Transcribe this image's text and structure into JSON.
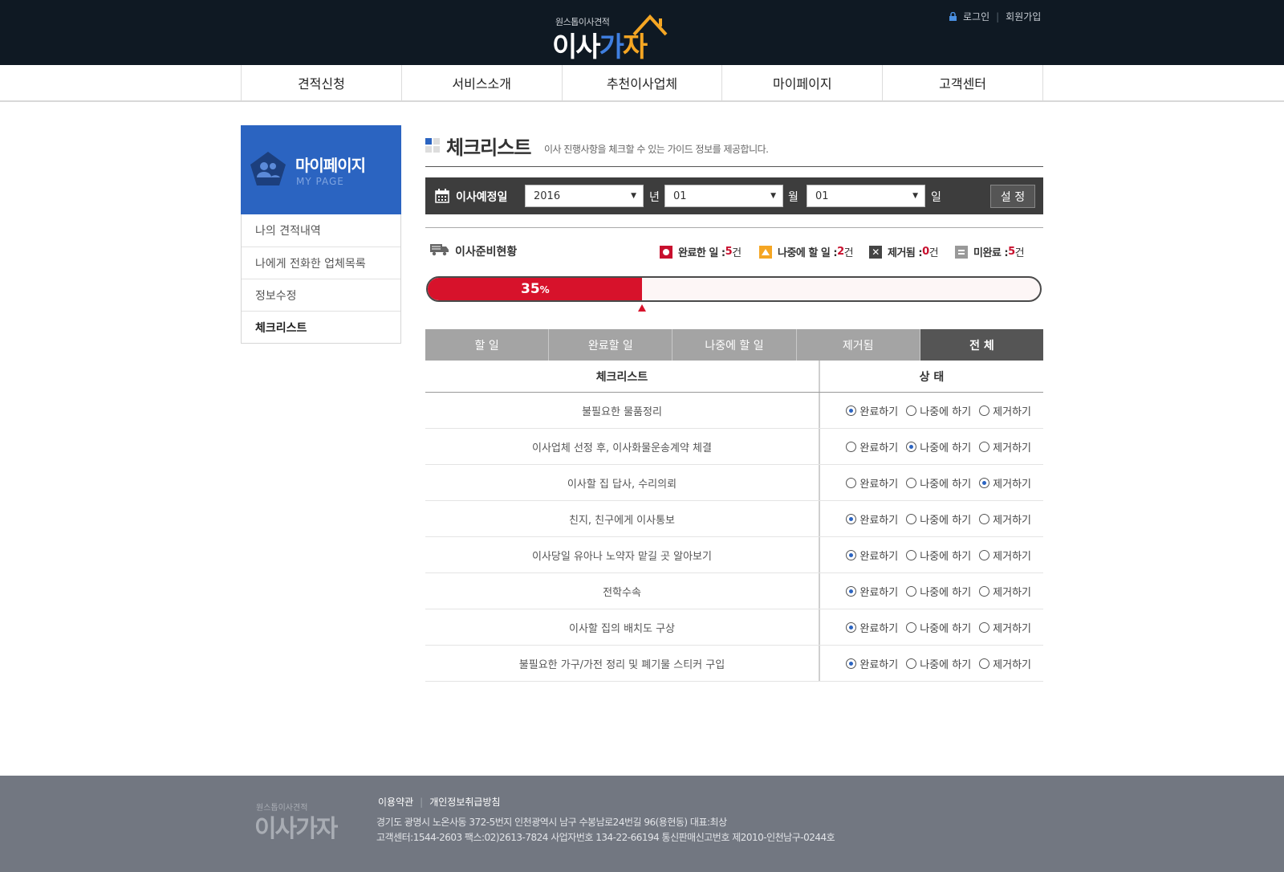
{
  "header": {
    "logo_small": "원스톱이사견적",
    "logo_part1": "이사",
    "logo_part2": "가",
    "logo_part3": "자",
    "login": "로그인",
    "signup": "회원가입"
  },
  "gnb": [
    "견적신청",
    "서비스소개",
    "추천이사업체",
    "마이페이지",
    "고객센터"
  ],
  "sidebar": {
    "title": "마이페이지",
    "subtitle": "MY PAGE",
    "items": [
      {
        "label": "나의 견적내역"
      },
      {
        "label": "나에게 전화한 업체목록"
      },
      {
        "label": "정보수정"
      },
      {
        "label": "체크리스트"
      }
    ]
  },
  "main": {
    "title": "체크리스트",
    "description": "이사 진행사항을 체크할 수 있는 가이드 정보를 제공합니다."
  },
  "date_bar": {
    "label": "이사예정일",
    "year": "2016",
    "year_unit": "년",
    "month": "01",
    "month_unit": "월",
    "day": "01",
    "day_unit": "일",
    "set_button": "설 정"
  },
  "status": {
    "title": "이사준비현황",
    "done_label": "완료한 일 : ",
    "done_count": "5",
    "later_label": "나중에 할 일 : ",
    "later_count": "2",
    "removed_label": "제거됨 : ",
    "removed_count": "0",
    "incomplete_label": "미완료 : ",
    "incomplete_count": "5",
    "count_unit": "건",
    "progress_value": "35",
    "progress_unit": "%",
    "colors": {
      "done": "#d7122b",
      "later": "#f5a623",
      "removed": "#444444",
      "incomplete": "#999999"
    }
  },
  "tabs": [
    "할 일",
    "완료할 일",
    "나중에 할 일",
    "제거됨",
    "전 체"
  ],
  "table": {
    "headers": [
      "체크리스트",
      "상 태"
    ],
    "options": [
      "완료하기",
      "나중에 하기",
      "제거하기"
    ],
    "rows": [
      {
        "task": "불필요한 물품정리",
        "status": 0
      },
      {
        "task": "이사업체 선정 후, 이사화물운송계약 체결",
        "status": 1
      },
      {
        "task": "이사할 집 답사, 수리의뢰",
        "status": 2
      },
      {
        "task": "친지, 친구에게 이사통보",
        "status": 0
      },
      {
        "task": "이사당일 유아나 노약자 맡길 곳 알아보기",
        "status": 0
      },
      {
        "task": "전학수속",
        "status": 0
      },
      {
        "task": "이사할 집의 배치도 구상",
        "status": 0
      },
      {
        "task": "불필요한 가구/가전 정리 및 폐기물 스티커 구입",
        "status": 0
      }
    ]
  },
  "footer": {
    "logo_small": "원스톱이사견적",
    "logo_big": "이사가자",
    "links": [
      "이용약관",
      "개인정보취급방침"
    ],
    "address": "경기도 광명시 노온사동 372-5번지 인천광역시 남구 수봉남로24번길 96(용현동)   대표:최상",
    "contact": "고객센터:1544-2603  팩스:02)2613-7824 사업자번호 134-22-66194   통신판매신고번호 제2010-인천남구-0244호"
  }
}
